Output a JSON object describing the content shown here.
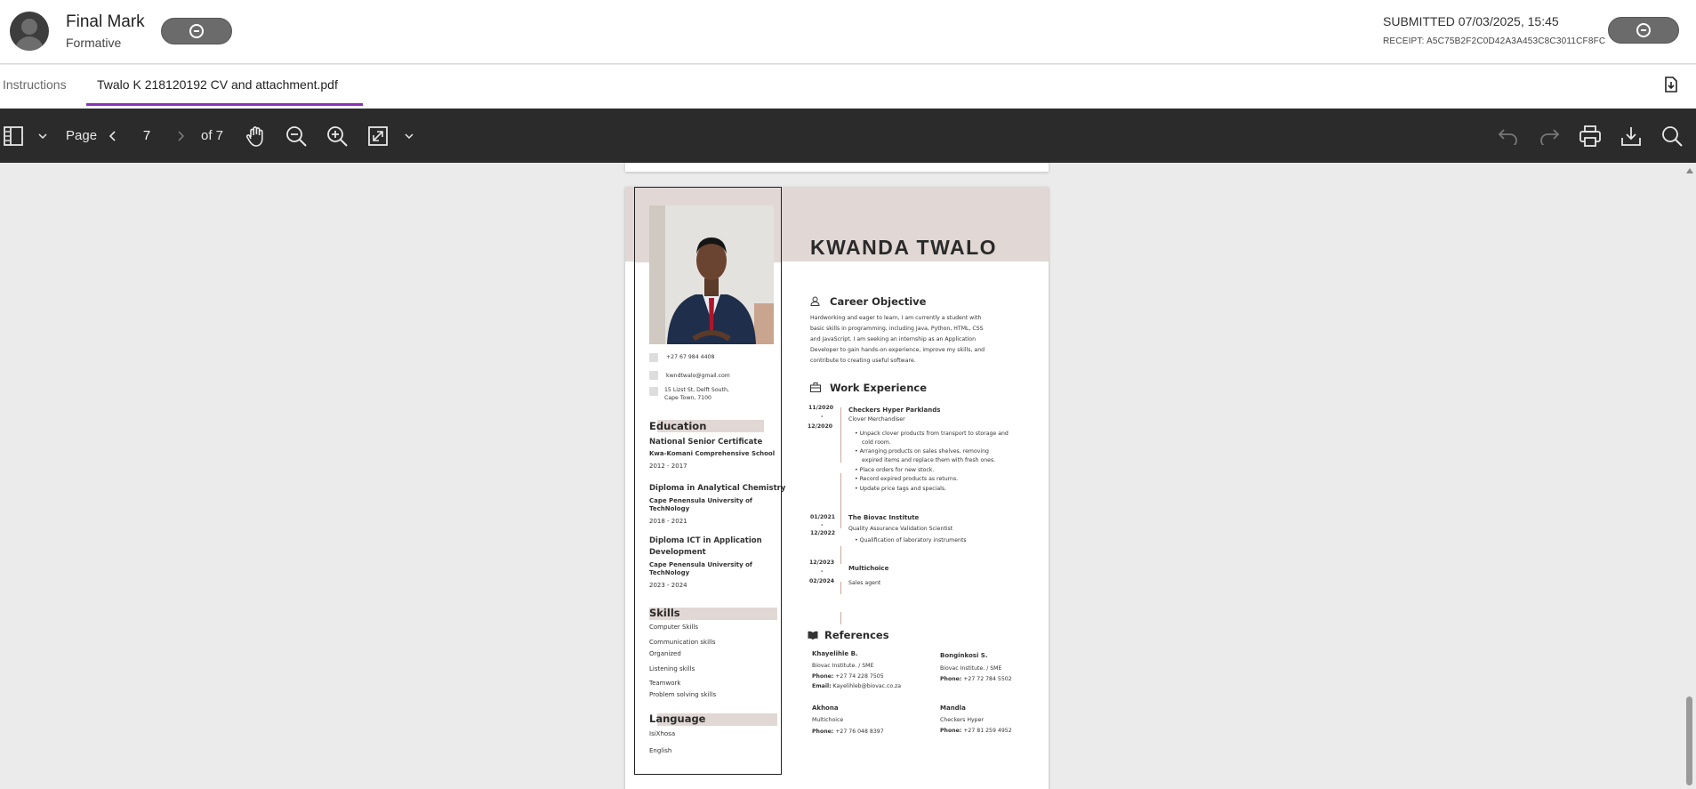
{
  "header": {
    "title": "Final Mark",
    "subtitle": "Formative",
    "submitted": "SUBMITTED 07/03/2025, 15:45",
    "receipt": "RECEIPT: A5C75B2F2C0D42A3A453C8C3011CF8FC"
  },
  "tabs": [
    {
      "label": "Instructions"
    },
    {
      "label": "Twalo K 218120192 CV and attachment.pdf"
    }
  ],
  "toolbar": {
    "page_label": "Page",
    "page_value": "7",
    "of_label": "of 7"
  },
  "cv": {
    "name": "KWANDA TWALO",
    "contact": {
      "phone": "+27 67 984 4408",
      "email": "kwndtwalo@gmail.com",
      "address_line1": "15 Lizst St, Delft South,",
      "address_line2": "Cape Town, 7100"
    },
    "education": {
      "heading": "Education",
      "items": [
        {
          "title": "National Senior Certificate",
          "school": "Kwa-Komani Comprehensive School",
          "years": "2012 - 2017"
        },
        {
          "title": "Diploma in Analytical Chemistry",
          "school_line1": "Cape Penensula University of",
          "school_line2": "TechNology",
          "years": "2018 - 2021"
        },
        {
          "title_line1": "Diploma ICT in Application",
          "title_line2": "Development",
          "school_line1": "Cape Penensula University of",
          "school_line2": "TechNology",
          "years": "2023 - 2024"
        }
      ]
    },
    "skills": {
      "heading": "Skills",
      "items": [
        "Computer Skills",
        "Communication skills",
        "Organized",
        "Listening skills",
        "Teamwork",
        "Problem solving skills"
      ]
    },
    "language": {
      "heading": "Language",
      "items": [
        "IsiXhosa",
        "English"
      ]
    },
    "career": {
      "heading": "Career Objective",
      "lines": [
        "Hardworking and eager to learn, I am currently a student with",
        "basic skills in programming, including Java, Python, HTML, CSS",
        "and JavaScript. I am seeking an internship as an Application",
        "Developer to gain hands-on experience, improve my skills, and",
        "contribute to creating useful software."
      ]
    },
    "work": {
      "heading": "Work Experience",
      "jobs": [
        {
          "from": "11/2020",
          "sep": "-",
          "to": "12/2020",
          "company": "Checkers Hyper Parklands",
          "role": "Clover Merchandiser",
          "bullets": [
            "Unpack clover products from transport to storage and",
            "cold room.",
            "Arranging products on sales shelves, removing",
            "expired items and replace them with fresh ones.",
            "Place orders for new stock.",
            "Record expired products as returns.",
            "Update price tags and specials."
          ]
        },
        {
          "from": "01/2021",
          "sep": "-",
          "to": "12/2022",
          "company": "The Biovac Institute",
          "role": "Quality Assurance Validation Scientist",
          "bullets": [
            "Qualification of laboratory instruments"
          ]
        },
        {
          "from": "12/2023",
          "sep": "-",
          "to": "02/2024",
          "company": "Multichoice",
          "role": "Sales agent",
          "bullets": []
        }
      ]
    },
    "references": {
      "heading": "References",
      "people": [
        {
          "name": "Khayelihle B.",
          "org": "Biovac Institute. / SME",
          "phone_label": "Phone:",
          "phone": "+27 74 228 7505",
          "email_label": "Email:",
          "email": "Kayelihleb@biovac.co.za"
        },
        {
          "name": "Bonginkosi S.",
          "org": "Biovac Institute. / SME",
          "phone_label": "Phone:",
          "phone": "+27 72 784 5502"
        },
        {
          "name": "Akhona",
          "org": "Multichoice",
          "phone_label": "Phone:",
          "phone": "+27 76 048 8397"
        },
        {
          "name": "Mandla",
          "org": "Checkers Hyper",
          "phone_label": "Phone:",
          "phone": "+27 81 259 4952"
        }
      ]
    }
  }
}
